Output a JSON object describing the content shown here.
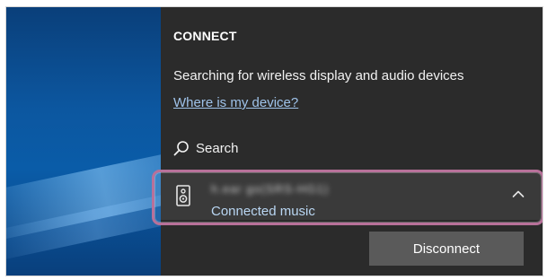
{
  "connect_panel": {
    "title": "CONNECT",
    "status_text": "Searching for wireless display and audio devices",
    "help_link": "Where is my device?",
    "search_label": "Search"
  },
  "device": {
    "name": "h.ear go(SRS-HG1)",
    "status": "Connected music",
    "icon": "speaker-icon",
    "expanded": true
  },
  "actions": {
    "disconnect_label": "Disconnect"
  },
  "colors": {
    "panel_bg": "#2b2b2b",
    "device_row_bg": "#3a3a3a",
    "link": "#9fc3ea",
    "status_accent": "#b9d6f2",
    "highlight_outline": "#b8719a",
    "button_bg": "#5a5a5a"
  }
}
